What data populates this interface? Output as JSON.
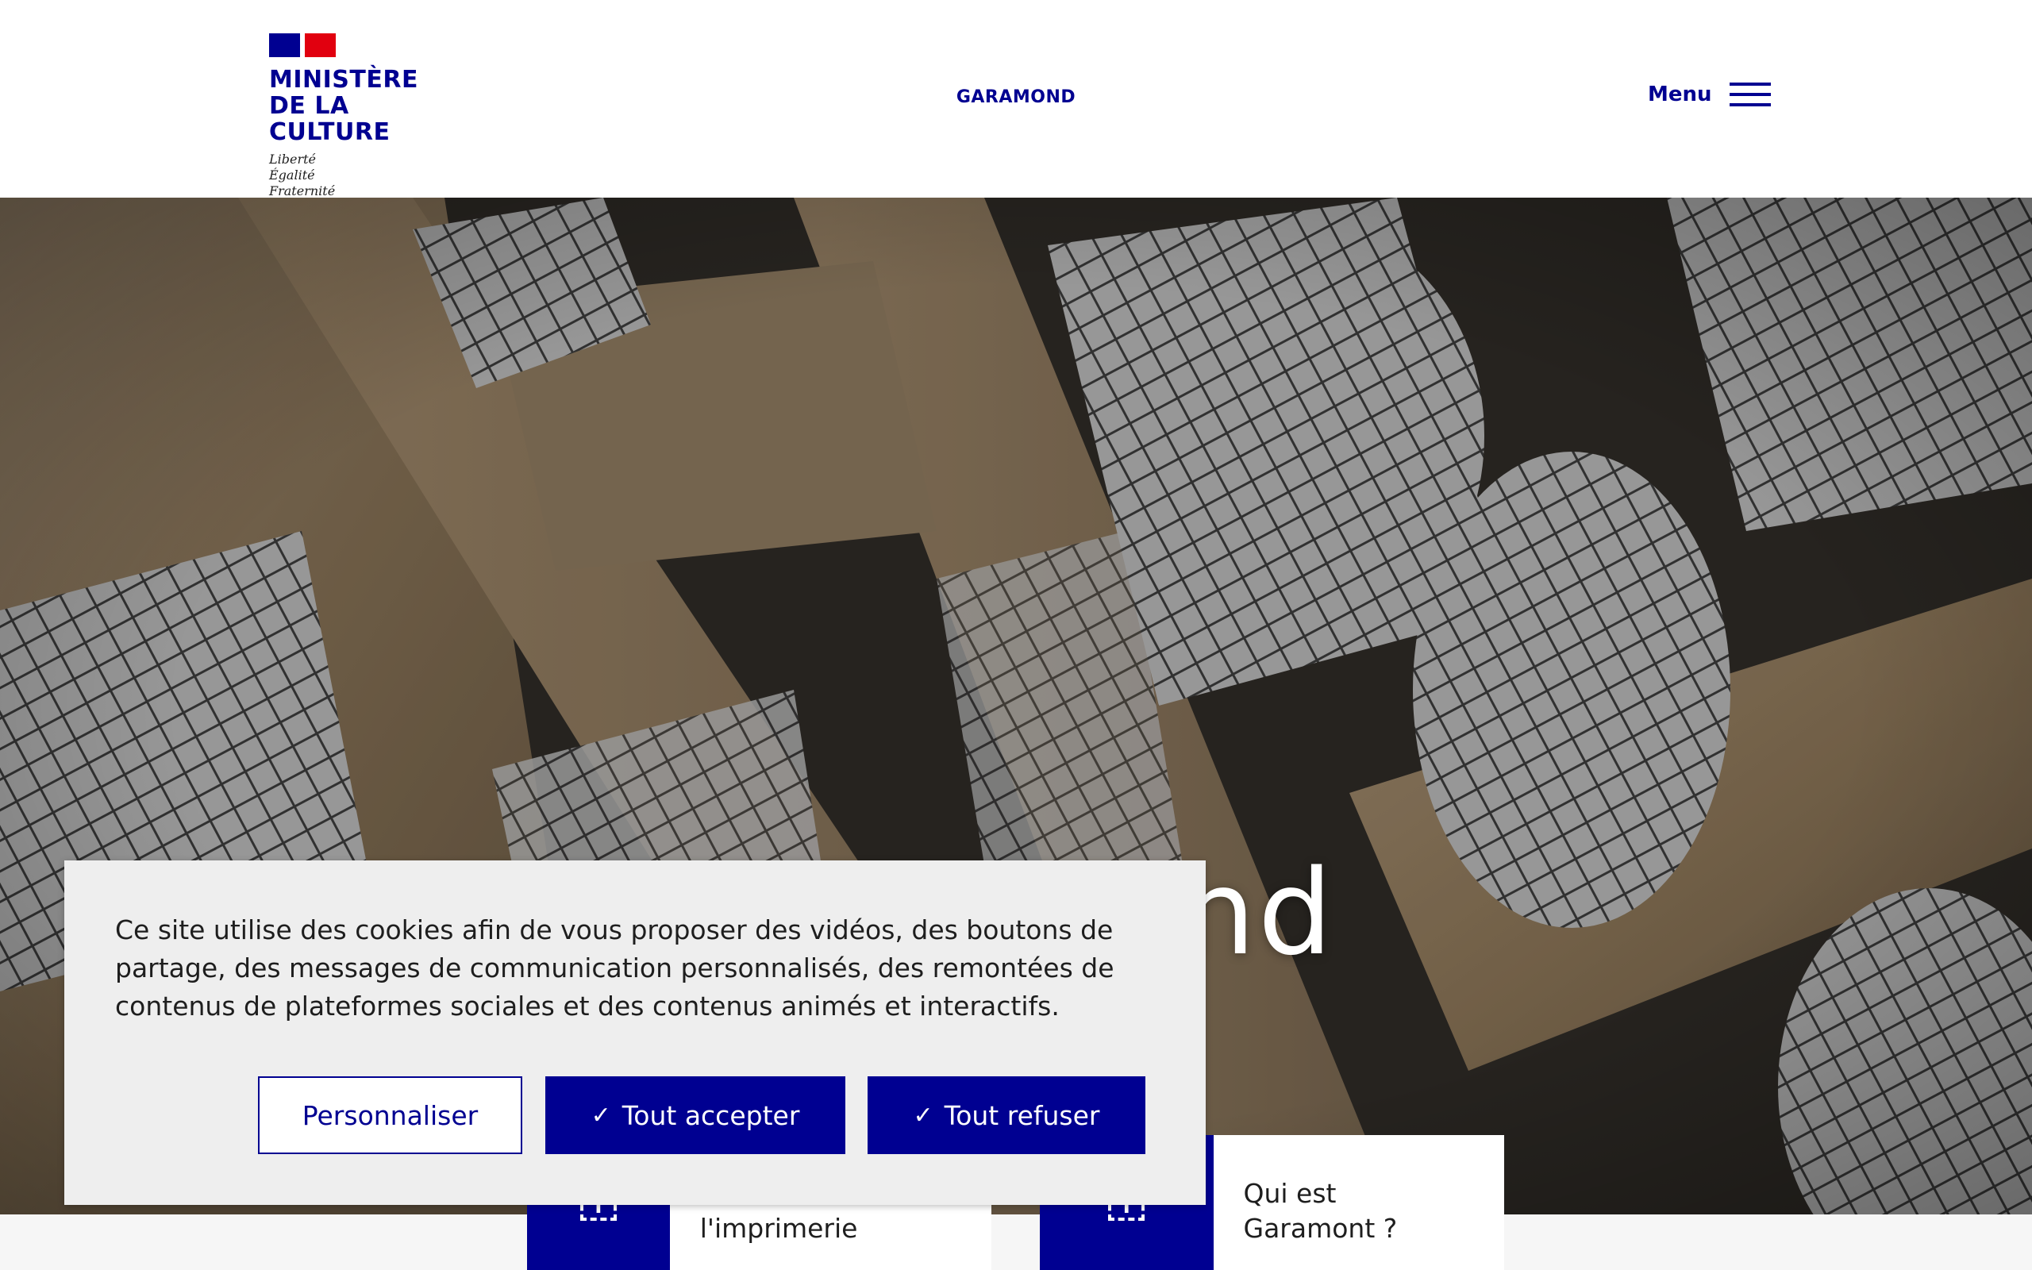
{
  "header": {
    "logo": {
      "title_line1": "MINISTÈRE",
      "title_line2": "DE LA CULTURE",
      "motto": [
        "Liberté",
        "Égalité",
        "Fraternité"
      ]
    },
    "site_name": "GARAMOND",
    "menu_label": "Menu",
    "menu_icon": "hamburger-icon"
  },
  "hero": {
    "title": "Garamond"
  },
  "cards": [
    {
      "text": "L'invention de l'imprimerie",
      "icon": "expand-plus-icon"
    },
    {
      "text": "Qui est Garamont ?",
      "icon": "expand-plus-icon"
    }
  ],
  "cookie_banner": {
    "message": "Ce site utilise des cookies afin de vous proposer des vidéos, des boutons de partage, des messages de communication personnalisés, des remontées de contenus de plateformes sociales et des contenus animés et interactifs.",
    "buttons": {
      "customize": "Personnaliser",
      "accept_all": "Tout accepter",
      "refuse_all": "Tout refuser",
      "check_glyph": "✓"
    }
  },
  "colors": {
    "primary": "#000091",
    "flag_red": "#e1000f",
    "banner_bg": "#eeeeee"
  }
}
